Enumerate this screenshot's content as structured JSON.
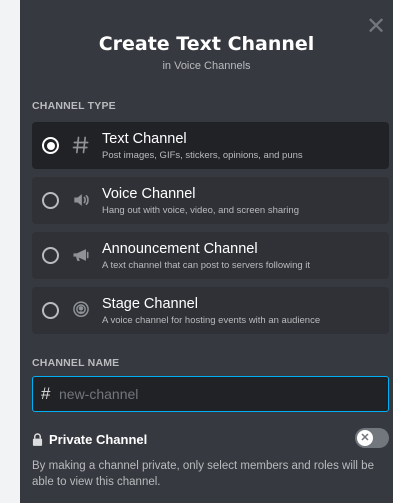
{
  "modal": {
    "title": "Create Text Channel",
    "subtitle": "in Voice Channels",
    "close_icon": "✕"
  },
  "channel_type": {
    "label": "CHANNEL TYPE",
    "options": [
      {
        "title": "Text Channel",
        "desc": "Post images, GIFs, stickers, opinions, and puns",
        "icon": "hash-icon",
        "selected": true
      },
      {
        "title": "Voice Channel",
        "desc": "Hang out with voice, video, and screen sharing",
        "icon": "speaker-icon",
        "selected": false
      },
      {
        "title": "Announcement Channel",
        "desc": "A text channel that can post to servers following it",
        "icon": "megaphone-icon",
        "selected": false
      },
      {
        "title": "Stage Channel",
        "desc": "A voice channel for hosting events with an audience",
        "icon": "stage-icon",
        "selected": false
      }
    ]
  },
  "channel_name": {
    "label": "CHANNEL NAME",
    "prefix": "#",
    "placeholder": "new-channel",
    "value": ""
  },
  "private": {
    "label": "Private Channel",
    "enabled": false,
    "toggle_glyph": "✕",
    "description": "By making a channel private, only select members and roles will be able to view this channel."
  },
  "colors": {
    "background": "#36393f",
    "selected_option": "#202225",
    "option": "#2f3136",
    "focus_border": "#00b0f4"
  }
}
